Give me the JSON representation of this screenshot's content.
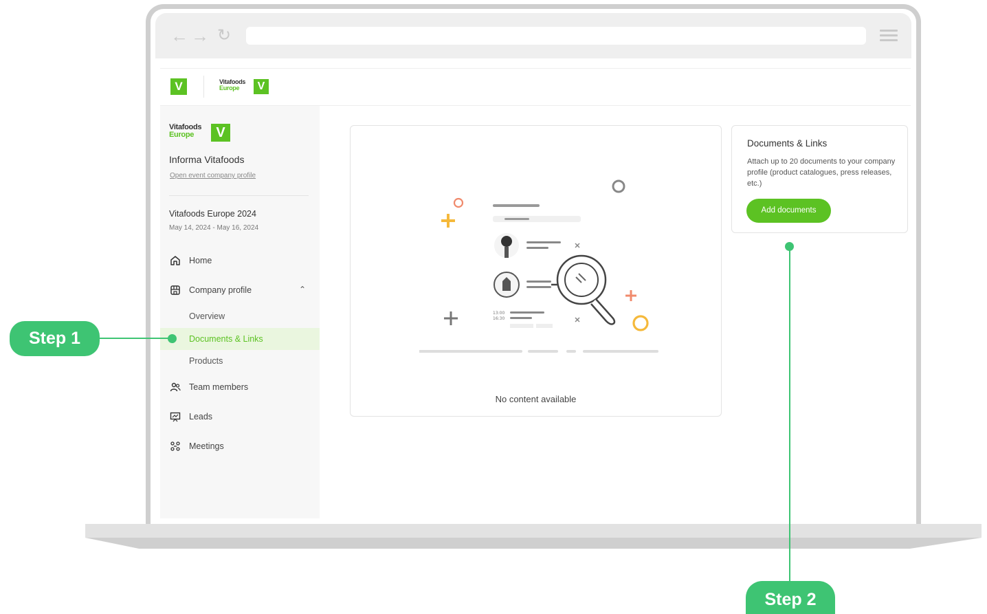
{
  "colors": {
    "brand_green": "#5cc223",
    "callout_green": "#3ec473",
    "active_bg": "#eaf6df"
  },
  "browser": {
    "back_icon": "arrow-left-icon",
    "forward_icon": "arrow-right-icon",
    "reload_icon": "reload-icon",
    "menu_icon": "hamburger-menu-icon"
  },
  "header": {
    "logo_letter": "V",
    "brand_line1": "Vitafoods",
    "brand_line2": "Europe",
    "brand_letter": "V"
  },
  "sidebar": {
    "brand_line1": "Vitafoods",
    "brand_line2": "Europe",
    "brand_letter": "V",
    "company_name": "Informa Vitafoods",
    "company_link": "Open event company profile",
    "event_name": "Vitafoods Europe 2024",
    "event_dates": "May 14, 2024 - May 16, 2024",
    "nav": {
      "home": "Home",
      "company_profile": "Company profile",
      "overview": "Overview",
      "documents_links": "Documents & Links",
      "products": "Products",
      "team_members": "Team members",
      "leads": "Leads",
      "meetings": "Meetings"
    }
  },
  "main": {
    "empty_text": "No content available",
    "illustration_time1": "13:00",
    "illustration_time2": "16:30"
  },
  "info_card": {
    "title": "Documents & Links",
    "description": "Attach up to 20 documents to your company profile (product catalogues, press releases, etc.)",
    "button_label": "Add documents"
  },
  "callouts": {
    "step1": "Step 1",
    "step2": "Step 2"
  }
}
